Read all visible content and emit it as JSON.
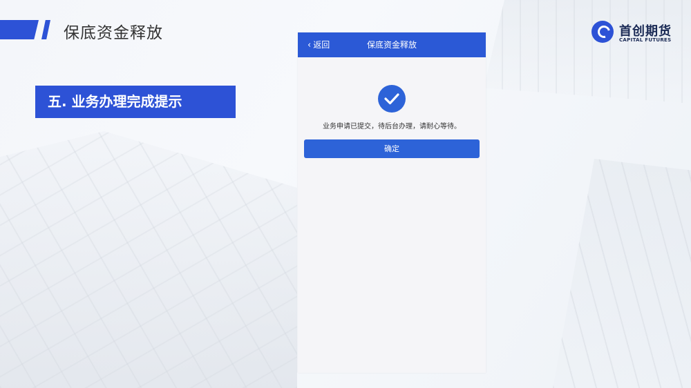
{
  "slide": {
    "title": "保底资金释放",
    "section_label": "五. 业务办理完成提示"
  },
  "logo": {
    "name_cn": "首创期货",
    "name_en": "CAPITAL FUTURES"
  },
  "phone": {
    "nav": {
      "back_label": "返回",
      "title": "保底资金释放"
    },
    "message": "业务申请已提交，待后台办理，请耐心等待。",
    "confirm_label": "确定"
  },
  "colors": {
    "brand_blue": "#2d52d6",
    "navbar_blue": "#2b59d6",
    "button_blue": "#2d63d8"
  },
  "icons": [
    "back-chevron-icon",
    "checkmark-circle-icon",
    "logo-mark-icon"
  ]
}
